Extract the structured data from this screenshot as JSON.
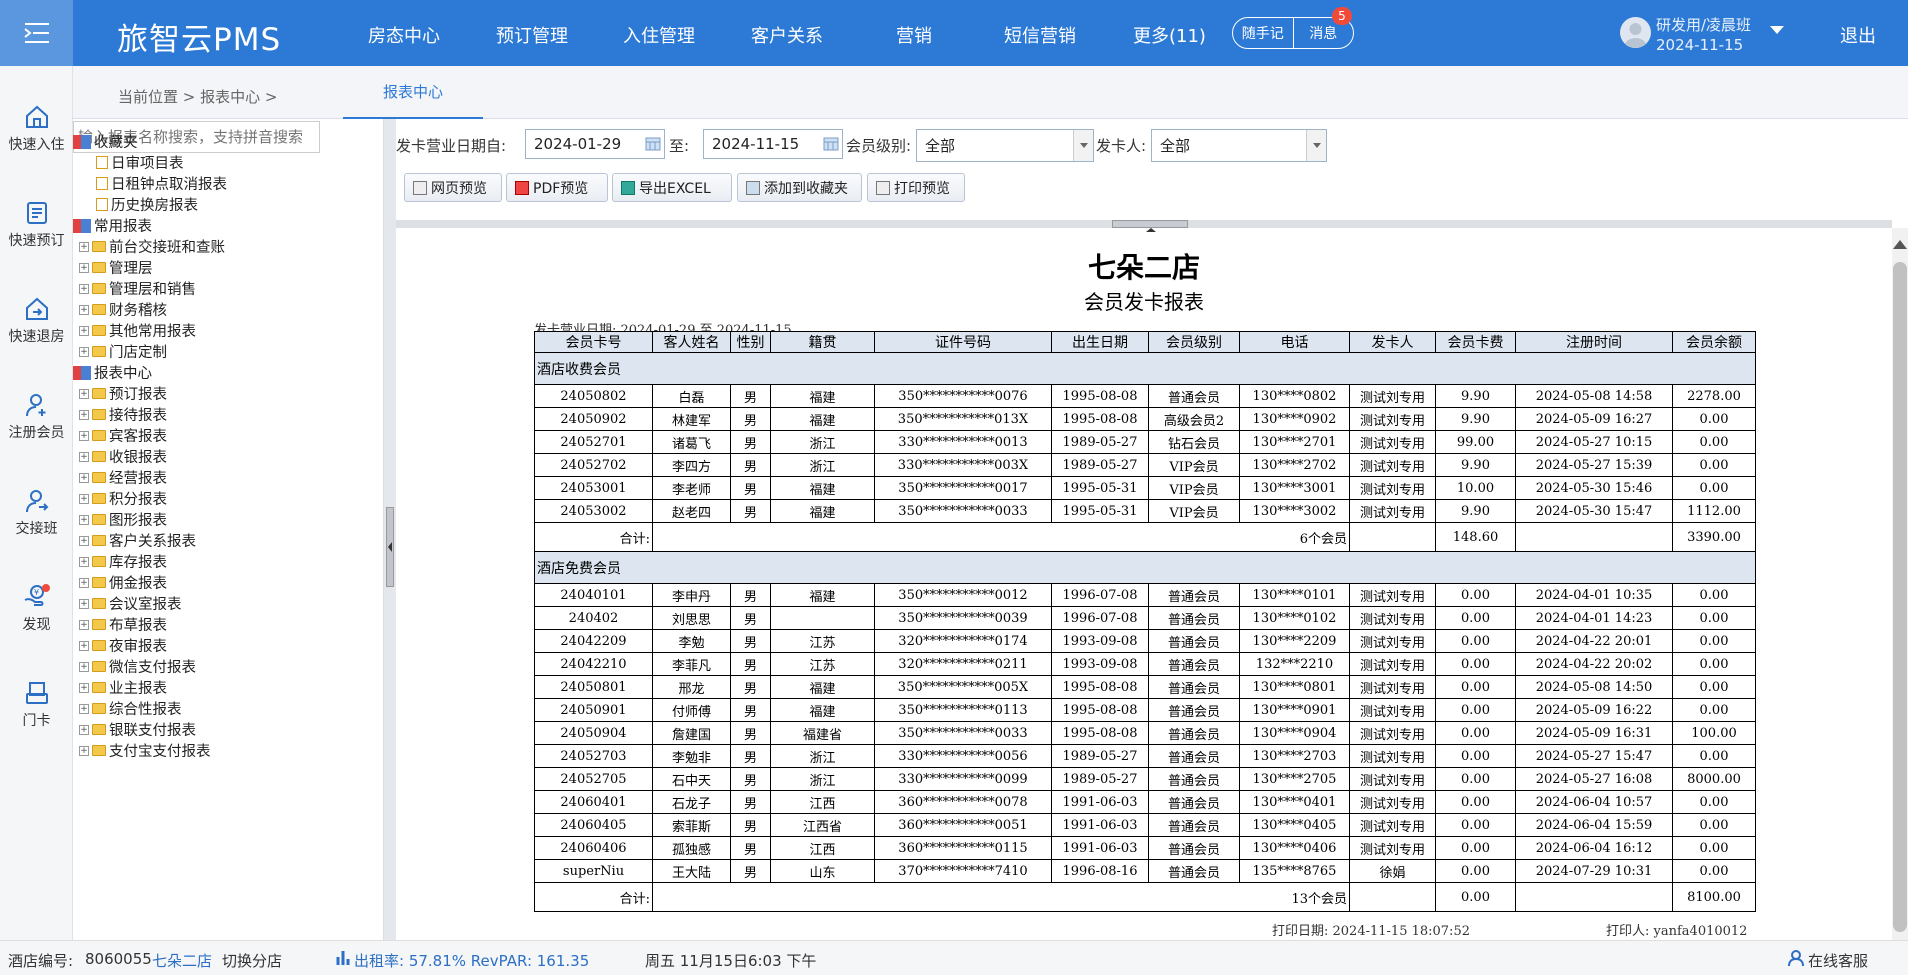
{
  "app": {
    "logo": "旅智云PMS",
    "nav": [
      "房态中心",
      "预订管理",
      "入住管理",
      "客户关系",
      "营销",
      "短信营销",
      "更多(11)"
    ],
    "memo": "随手记",
    "message": "消息",
    "message_count": "5",
    "user": "研发用/凌晨班",
    "date": "2024-11-15",
    "logout": "退出"
  },
  "quick": [
    {
      "label": "快速入住",
      "icon": "home-icon"
    },
    {
      "label": "快速预订",
      "icon": "calendar-icon"
    },
    {
      "label": "快速退房",
      "icon": "checkout-icon"
    },
    {
      "label": "注册会员",
      "icon": "add-user-icon"
    },
    {
      "label": "交接班",
      "icon": "shift-icon"
    },
    {
      "label": "发现",
      "icon": "discover-icon"
    },
    {
      "label": "门卡",
      "icon": "card-icon"
    }
  ],
  "breadcrumb": {
    "text": "当前位置  >  报表中心  >",
    "tab": "报表中心"
  },
  "tree": {
    "search_placeholder": "输入报表名称搜索，支持拼音搜索",
    "groups": [
      {
        "label": "收藏夹",
        "items": [
          "日审项目表",
          "日租钟点取消报表",
          "历史换房报表"
        ]
      },
      {
        "label": "常用报表",
        "items": [
          "前台交接班和查账",
          "管理层",
          "管理层和销售",
          "财务稽核",
          "其他常用报表",
          "门店定制"
        ]
      },
      {
        "label": "报表中心",
        "items": [
          "预订报表",
          "接待报表",
          "宾客报表",
          "收银报表",
          "经营报表",
          "积分报表",
          "图形报表",
          "客户关系报表",
          "库存报表",
          "佣金报表",
          "会议室报表",
          "布草报表",
          "夜审报表",
          "微信支付报表",
          "业主报表",
          "综合性报表",
          "银联支付报表",
          "支付宝支付报表"
        ]
      }
    ]
  },
  "filter": {
    "date_from_label": "发卡营业日期自:",
    "date_from": "2024-01-29",
    "to_label": "至:",
    "date_to": "2024-11-15",
    "level_label": "会员级别:",
    "level": "全部",
    "issuer_label": "发卡人:",
    "issuer": "全部",
    "buttons": [
      "网页预览",
      "PDF预览",
      "导出EXCEL",
      "添加到收藏夹",
      "打印预览"
    ]
  },
  "report": {
    "hotel": "七朵二店",
    "title": "会员发卡报表",
    "range": "发卡营业日期: 2024-01-29 至 2024-11-15",
    "headers": [
      "会员卡号",
      "客人姓名",
      "性别",
      "籍贯",
      "证件号码",
      "出生日期",
      "会员级别",
      "电话",
      "发卡人",
      "会员卡费",
      "注册时间",
      "会员余额"
    ],
    "groups": [
      {
        "name": "酒店收费会员",
        "rows": [
          [
            "24050802",
            "白磊",
            "男",
            "福建",
            "350***********0076",
            "1995-08-08",
            "普通会员",
            "130****0802",
            "测试刘专用",
            "9.90",
            "2024-05-08 14:58",
            "2278.00"
          ],
          [
            "24050902",
            "林建军",
            "男",
            "福建",
            "350***********013X",
            "1995-08-08",
            "高级会员2",
            "130****0902",
            "测试刘专用",
            "9.90",
            "2024-05-09 16:27",
            "0.00"
          ],
          [
            "24052701",
            "诸葛飞",
            "男",
            "浙江",
            "330***********0013",
            "1989-05-27",
            "钻石会员",
            "130****2701",
            "测试刘专用",
            "99.00",
            "2024-05-27 10:15",
            "0.00"
          ],
          [
            "24052702",
            "李四方",
            "男",
            "浙江",
            "330***********003X",
            "1989-05-27",
            "VIP会员",
            "130****2702",
            "测试刘专用",
            "9.90",
            "2024-05-27 15:39",
            "0.00"
          ],
          [
            "24053001",
            "李老师",
            "男",
            "福建",
            "350***********0017",
            "1995-05-31",
            "VIP会员",
            "130****3001",
            "测试刘专用",
            "10.00",
            "2024-05-30 15:46",
            "0.00"
          ],
          [
            "24053002",
            "赵老四",
            "男",
            "福建",
            "350***********0033",
            "1995-05-31",
            "VIP会员",
            "130****3002",
            "测试刘专用",
            "9.90",
            "2024-05-30 15:47",
            "1112.00"
          ]
        ],
        "sum": {
          "label": "合计:",
          "count": "6个会员",
          "fee": "148.60",
          "balance": "3390.00"
        }
      },
      {
        "name": "酒店免费会员",
        "rows": [
          [
            "24040101",
            "李申丹",
            "男",
            "福建",
            "350***********0012",
            "1996-07-08",
            "普通会员",
            "130****0101",
            "测试刘专用",
            "0.00",
            "2024-04-01 10:35",
            "0.00"
          ],
          [
            "240402",
            "刘思思",
            "男",
            "",
            "350***********0039",
            "1996-07-08",
            "普通会员",
            "130****0102",
            "测试刘专用",
            "0.00",
            "2024-04-01 14:23",
            "0.00"
          ],
          [
            "24042209",
            "李勉",
            "男",
            "江苏",
            "320***********0174",
            "1993-09-08",
            "普通会员",
            "130****2209",
            "测试刘专用",
            "0.00",
            "2024-04-22 20:01",
            "0.00"
          ],
          [
            "24042210",
            "李菲凡",
            "男",
            "江苏",
            "320***********0211",
            "1993-09-08",
            "普通会员",
            "132***2210",
            "测试刘专用",
            "0.00",
            "2024-04-22 20:02",
            "0.00"
          ],
          [
            "24050801",
            "邢龙",
            "男",
            "福建",
            "350***********005X",
            "1995-08-08",
            "普通会员",
            "130****0801",
            "测试刘专用",
            "0.00",
            "2024-05-08 14:50",
            "0.00"
          ],
          [
            "24050901",
            "付师傅",
            "男",
            "福建",
            "350***********0113",
            "1995-08-08",
            "普通会员",
            "130****0901",
            "测试刘专用",
            "0.00",
            "2024-05-09 16:22",
            "0.00"
          ],
          [
            "24050904",
            "詹建国",
            "男",
            "福建省",
            "350***********0033",
            "1995-08-08",
            "普通会员",
            "130****0904",
            "测试刘专用",
            "0.00",
            "2024-05-09 16:31",
            "100.00"
          ],
          [
            "24052703",
            "李勉非",
            "男",
            "浙江",
            "330***********0056",
            "1989-05-27",
            "普通会员",
            "130****2703",
            "测试刘专用",
            "0.00",
            "2024-05-27 15:47",
            "0.00"
          ],
          [
            "24052705",
            "石中天",
            "男",
            "浙江",
            "330***********0099",
            "1989-05-27",
            "普通会员",
            "130****2705",
            "测试刘专用",
            "0.00",
            "2024-05-27 16:08",
            "8000.00"
          ],
          [
            "24060401",
            "石龙子",
            "男",
            "江西",
            "360***********0078",
            "1991-06-03",
            "普通会员",
            "130****0401",
            "测试刘专用",
            "0.00",
            "2024-06-04 10:57",
            "0.00"
          ],
          [
            "24060405",
            "索菲斯",
            "男",
            "江西省",
            "360***********0051",
            "1991-06-03",
            "普通会员",
            "130****0405",
            "测试刘专用",
            "0.00",
            "2024-06-04 15:59",
            "0.00"
          ],
          [
            "24060406",
            "孤独感",
            "男",
            "江西",
            "360***********0115",
            "1991-06-03",
            "普通会员",
            "130****0406",
            "测试刘专用",
            "0.00",
            "2024-06-04 16:12",
            "0.00"
          ],
          [
            "superNiu",
            "王大陆",
            "男",
            "山东",
            "370***********7410",
            "1996-08-16",
            "普通会员",
            "135****8765",
            "徐娟",
            "0.00",
            "2024-07-29 10:31",
            "0.00"
          ]
        ],
        "sum": {
          "label": "合计:",
          "count": "13个会员",
          "fee": "0.00",
          "balance": "8100.00"
        }
      }
    ],
    "print_date": "打印日期: 2024-11-15 18:07:52",
    "printer": "打印人: yanfa4010012"
  },
  "status": {
    "hotel_no_label": "酒店编号:",
    "hotel_no": "8060055",
    "hotel_name": "七朵二店",
    "switch": "切换分店",
    "occupancy": "出租率: 57.81% RevPAR: 161.35",
    "datetime": "周五 11月15日6:03 下午",
    "service": "在线客服"
  }
}
